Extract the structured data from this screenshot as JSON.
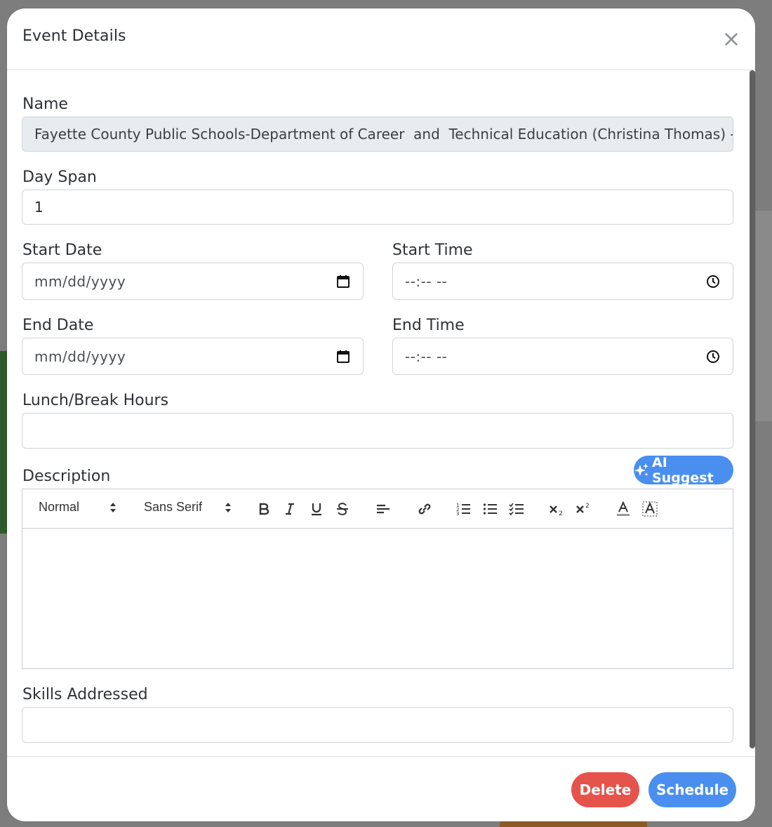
{
  "modal": {
    "title": "Event Details",
    "close_icon": "close-icon"
  },
  "form": {
    "name": {
      "label": "Name",
      "value": "Fayette County Public Schools-Department of Career  and  Technical Education (Christina Thomas) - Co"
    },
    "day_span": {
      "label": "Day Span",
      "value": "1"
    },
    "start_date": {
      "label": "Start Date",
      "placeholder": "mm/dd/yyyy",
      "icon": "calendar-icon"
    },
    "start_time": {
      "label": "Start Time",
      "placeholder": "--:-- --",
      "icon": "clock-icon"
    },
    "end_date": {
      "label": "End Date",
      "placeholder": "mm/dd/yyyy",
      "icon": "calendar-icon"
    },
    "end_time": {
      "label": "End Time",
      "placeholder": "--:-- --",
      "icon": "clock-icon"
    },
    "lunch_break": {
      "label": "Lunch/Break Hours",
      "value": ""
    },
    "description": {
      "label": "Description",
      "ai_suggest_label": "AI Suggest",
      "ai_icon": "sparkle-icon",
      "toolbar": {
        "header_select": "Normal",
        "font_select": "Sans Serif",
        "buttons": [
          "bold-icon",
          "italic-icon",
          "underline-icon",
          "strike-icon",
          "align-left-icon",
          "link-icon",
          "ordered-list-icon",
          "bullet-list-icon",
          "check-list-icon",
          "subscript-icon",
          "superscript-icon",
          "text-color-icon",
          "background-color-icon"
        ]
      },
      "value": ""
    },
    "skills": {
      "label": "Skills Addressed",
      "value": ""
    }
  },
  "footer": {
    "delete_label": "Delete",
    "schedule_label": "Schedule"
  },
  "colors": {
    "primary": "#4a8ff0",
    "danger": "#e5534b",
    "readonly_bg": "#e9ecef"
  }
}
